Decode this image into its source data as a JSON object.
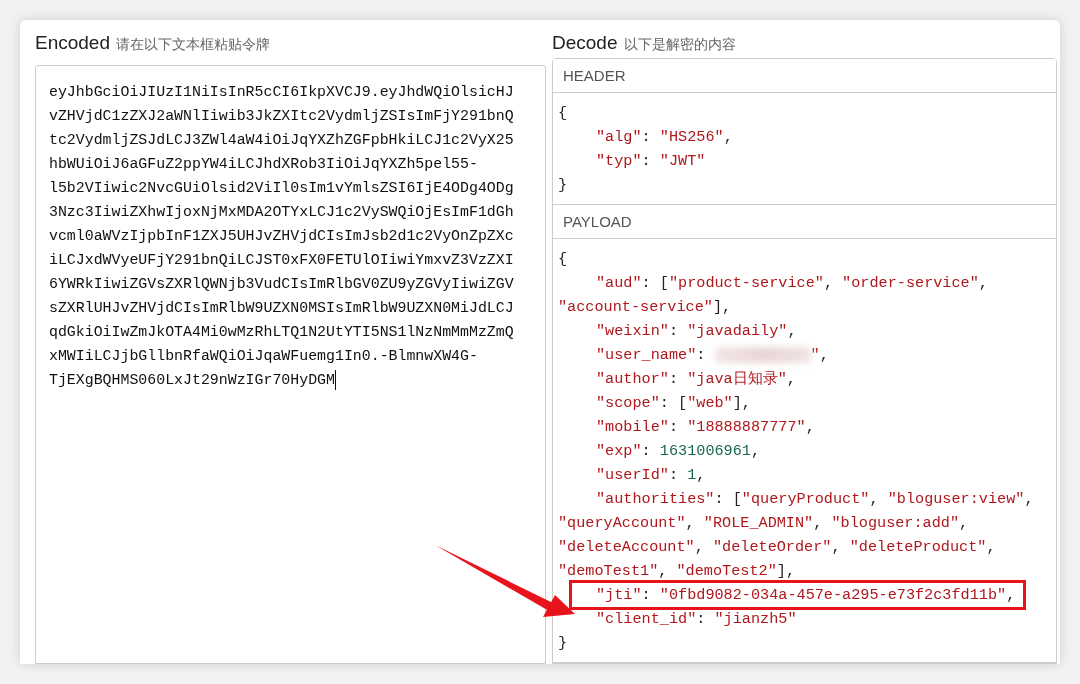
{
  "encoded": {
    "title": "Encoded",
    "subtitle": "请在以下文本框粘贴令牌",
    "lines": [
      "eyJhbGciOiJIUzI1NiIsInR5cCI6IkpXVCJ9.eyJhdWQiOlsicHJ",
      "vZHVjdC1zZXJ2aWNlIiwib3JkZXItc2VydmljZSIsImFjY291bnQ",
      "tc2VydmljZSJdLCJ3ZWl4aW4iOiJqYXZhZGFpbHkiLCJ1c2VyX25",
      "hbWUiOiJ6aGFuZ2ppYW4iLCJhdXRob3IiOiJqYXZh5pel55-",
      "l5b2VIiwic2NvcGUiOlsid2ViIl0sIm1vYmlsZSI6IjE4ODg4ODg",
      "3Nzc3IiwiZXhwIjoxNjMxMDA2OTYxLCJ1c2VySWQiOjEsImF1dGh",
      "vcml0aWVzIjpbInF1ZXJ5UHJvZHVjdCIsImJsb2d1c2VyOnZpZXc",
      "iLCJxdWVyeUFjY291bnQiLCJST0xFX0FETUlOIiwiYmxvZ3VzZXI",
      "6YWRkIiwiZGVsZXRlQWNjb3VudCIsImRlbGV0ZU9yZGVyIiwiZGV",
      "sZXRlUHJvZHVjdCIsImRlbW9UZXN0MSIsImRlbW9UZXN0MiJdLCJ",
      "qdGkiOiIwZmJkOTA4Mi0wMzRhLTQ1N2UtYTI5NS1lNzNmMmMzZmQ",
      "xMWIiLCJjbGllbnRfaWQiOiJqaWFuemg1In0.-BlmnwXW4G-",
      "TjEXgBQHMS060LxJt29nWzIGr70HyDGM"
    ]
  },
  "decode": {
    "title": "Decode",
    "subtitle": "以下是解密的内容",
    "sections": [
      {
        "title": "HEADER",
        "lines": [
          {
            "kind": "brace",
            "parts": [
              {
                "kind": "punct",
                "text": "{"
              }
            ]
          },
          {
            "kind": "entry",
            "parts": [
              {
                "kind": "str",
                "text": "\"alg\""
              },
              {
                "kind": "punct",
                "text": ": "
              },
              {
                "kind": "str",
                "text": "\"HS256\""
              },
              {
                "kind": "punct",
                "text": ","
              }
            ]
          },
          {
            "kind": "entry",
            "parts": [
              {
                "kind": "str",
                "text": "\"typ\""
              },
              {
                "kind": "punct",
                "text": ": "
              },
              {
                "kind": "str",
                "text": "\"JWT\""
              }
            ]
          },
          {
            "kind": "brace",
            "parts": [
              {
                "kind": "punct",
                "text": "}"
              }
            ]
          }
        ]
      },
      {
        "title": "PAYLOAD",
        "lines": [
          {
            "kind": "brace",
            "parts": [
              {
                "kind": "punct",
                "text": "{"
              }
            ]
          },
          {
            "kind": "entry",
            "parts": [
              {
                "kind": "str",
                "text": "\"aud\""
              },
              {
                "kind": "punct",
                "text": ": ["
              },
              {
                "kind": "str",
                "text": "\"product-service\""
              },
              {
                "kind": "punct",
                "text": ", "
              },
              {
                "kind": "str",
                "text": "\"order-service\""
              },
              {
                "kind": "punct",
                "text": ","
              }
            ]
          },
          {
            "kind": "wrap",
            "parts": [
              {
                "kind": "str",
                "text": "\"account-service\""
              },
              {
                "kind": "punct",
                "text": "],"
              }
            ]
          },
          {
            "kind": "entry",
            "parts": [
              {
                "kind": "str",
                "text": "\"weixin\""
              },
              {
                "kind": "punct",
                "text": ": "
              },
              {
                "kind": "str",
                "text": "\"javadaily\""
              },
              {
                "kind": "punct",
                "text": ","
              }
            ]
          },
          {
            "kind": "entry",
            "parts": [
              {
                "kind": "str",
                "text": "\"user_name\""
              },
              {
                "kind": "punct",
                "text": ": "
              },
              {
                "kind": "redacted"
              },
              {
                "kind": "str",
                "text": "\""
              },
              {
                "kind": "punct",
                "text": ","
              }
            ]
          },
          {
            "kind": "entry",
            "parts": [
              {
                "kind": "str",
                "text": "\"author\""
              },
              {
                "kind": "punct",
                "text": ": "
              },
              {
                "kind": "str",
                "text": "\"java日知录\""
              },
              {
                "kind": "punct",
                "text": ","
              }
            ]
          },
          {
            "kind": "entry",
            "parts": [
              {
                "kind": "str",
                "text": "\"scope\""
              },
              {
                "kind": "punct",
                "text": ": ["
              },
              {
                "kind": "str",
                "text": "\"web\""
              },
              {
                "kind": "punct",
                "text": "],"
              }
            ]
          },
          {
            "kind": "entry",
            "parts": [
              {
                "kind": "str",
                "text": "\"mobile\""
              },
              {
                "kind": "punct",
                "text": ": "
              },
              {
                "kind": "str",
                "text": "\"18888887777\""
              },
              {
                "kind": "punct",
                "text": ","
              }
            ]
          },
          {
            "kind": "entry",
            "parts": [
              {
                "kind": "str",
                "text": "\"exp\""
              },
              {
                "kind": "punct",
                "text": ": "
              },
              {
                "kind": "num",
                "text": "1631006961"
              },
              {
                "kind": "punct",
                "text": ","
              }
            ]
          },
          {
            "kind": "entry",
            "parts": [
              {
                "kind": "str",
                "text": "\"userId\""
              },
              {
                "kind": "punct",
                "text": ": "
              },
              {
                "kind": "num",
                "text": "1"
              },
              {
                "kind": "punct",
                "text": ","
              }
            ]
          },
          {
            "kind": "entry",
            "parts": [
              {
                "kind": "str",
                "text": "\"authorities\""
              },
              {
                "kind": "punct",
                "text": ": ["
              },
              {
                "kind": "str",
                "text": "\"queryProduct\""
              },
              {
                "kind": "punct",
                "text": ", "
              },
              {
                "kind": "str",
                "text": "\"bloguser:view\""
              },
              {
                "kind": "punct",
                "text": ","
              }
            ]
          },
          {
            "kind": "wrap",
            "parts": [
              {
                "kind": "str",
                "text": "\"queryAccount\""
              },
              {
                "kind": "punct",
                "text": ", "
              },
              {
                "kind": "str",
                "text": "\"ROLE_ADMIN\""
              },
              {
                "kind": "punct",
                "text": ", "
              },
              {
                "kind": "str",
                "text": "\"bloguser:add\""
              },
              {
                "kind": "punct",
                "text": ","
              }
            ]
          },
          {
            "kind": "wrap",
            "parts": [
              {
                "kind": "str",
                "text": "\"deleteAccount\""
              },
              {
                "kind": "punct",
                "text": ", "
              },
              {
                "kind": "str",
                "text": "\"deleteOrder\""
              },
              {
                "kind": "punct",
                "text": ", "
              },
              {
                "kind": "str",
                "text": "\"deleteProduct\""
              },
              {
                "kind": "punct",
                "text": ","
              }
            ]
          },
          {
            "kind": "wrap",
            "parts": [
              {
                "kind": "str",
                "text": "\"demoTest1\""
              },
              {
                "kind": "punct",
                "text": ", "
              },
              {
                "kind": "str",
                "text": "\"demoTest2\""
              },
              {
                "kind": "punct",
                "text": "],"
              }
            ]
          },
          {
            "kind": "entry",
            "highlighted": true,
            "parts": [
              {
                "kind": "str",
                "text": "\"jti\""
              },
              {
                "kind": "punct",
                "text": ": "
              },
              {
                "kind": "str",
                "text": "\"0fbd9082-034a-457e-a295-e73f2c3fd11b\""
              },
              {
                "kind": "punct",
                "text": ","
              }
            ]
          },
          {
            "kind": "entry",
            "parts": [
              {
                "kind": "str",
                "text": "\"client_id\""
              },
              {
                "kind": "punct",
                "text": ": "
              },
              {
                "kind": "str",
                "text": "\"jianzh5\""
              }
            ]
          },
          {
            "kind": "brace",
            "parts": [
              {
                "kind": "punct",
                "text": "}"
              }
            ]
          }
        ]
      }
    ]
  }
}
